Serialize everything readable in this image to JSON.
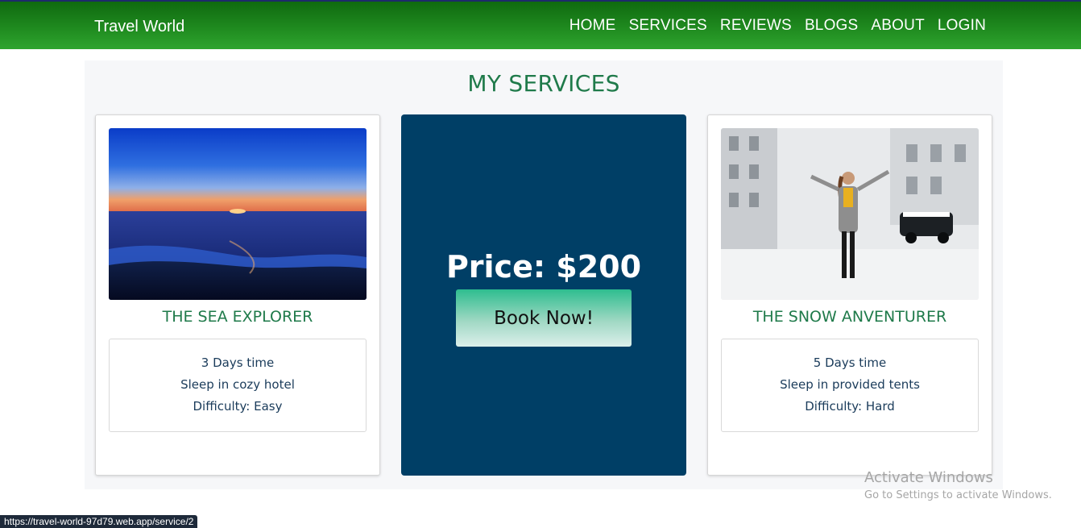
{
  "header": {
    "brand": "Travel World",
    "nav": [
      "HOME",
      "SERVICES",
      "REVIEWS",
      "BLOGS",
      "ABOUT",
      "LOGIN"
    ]
  },
  "services_section": {
    "title": "MY SERVICES",
    "left_card": {
      "image": "sea-sunset-photo",
      "title": "THE SEA EXPLORER",
      "details": [
        "3 Days time",
        "Sleep in cozy hotel",
        "Difficulty: Easy"
      ]
    },
    "price_card": {
      "price": "Price: $200",
      "button": "Book Now!"
    },
    "right_card": {
      "image": "snow-street-photo",
      "title": "THE SNOW ANVENTURER",
      "details": [
        "5 Days time",
        "Sleep in provided tents",
        "Difficulty: Hard"
      ]
    }
  },
  "watermark": {
    "line1": "Activate Windows",
    "line2": "Go to Settings to activate Windows."
  },
  "status_bar": {
    "url": "https://travel-world-97d79.web.app/service/2"
  },
  "colors": {
    "header_green": "#1f8a1f",
    "title_green": "#1f7a4a",
    "price_card_bg": "#003f66",
    "button_accent": "#2ebd8f"
  }
}
